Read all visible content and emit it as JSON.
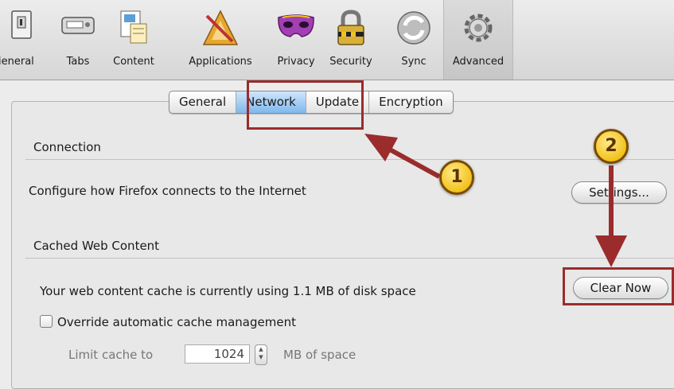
{
  "toolbar": {
    "items": [
      {
        "label": "ieneral",
        "icon": "general-switch-icon"
      },
      {
        "label": "Tabs",
        "icon": "tabs-icon"
      },
      {
        "label": "Content",
        "icon": "content-icon"
      },
      {
        "label": "Applications",
        "icon": "applications-icon"
      },
      {
        "label": "Privacy",
        "icon": "privacy-mask-icon"
      },
      {
        "label": "Security",
        "icon": "security-lock-icon"
      },
      {
        "label": "Sync",
        "icon": "sync-icon"
      },
      {
        "label": "Advanced",
        "icon": "advanced-gear-icon"
      }
    ],
    "selected": "Advanced"
  },
  "subtabs": {
    "items": [
      "General",
      "Network",
      "Update",
      "Encryption"
    ],
    "selected": "Network"
  },
  "connection": {
    "heading": "Connection",
    "description": "Configure how Firefox connects to the Internet",
    "settings_button": "Settings..."
  },
  "cache": {
    "heading": "Cached Web Content",
    "usage_text": "Your web content cache is currently using 1.1 MB of disk space",
    "clear_button": "Clear Now",
    "override_label": "Override automatic cache management",
    "override_checked": false,
    "limit_label": "Limit cache to",
    "limit_value": "1024",
    "limit_unit": "MB of space"
  },
  "annotations": {
    "step1": "1",
    "step2": "2",
    "highlight_color": "#9b2c2c",
    "callout_color": "#f2c21c"
  }
}
